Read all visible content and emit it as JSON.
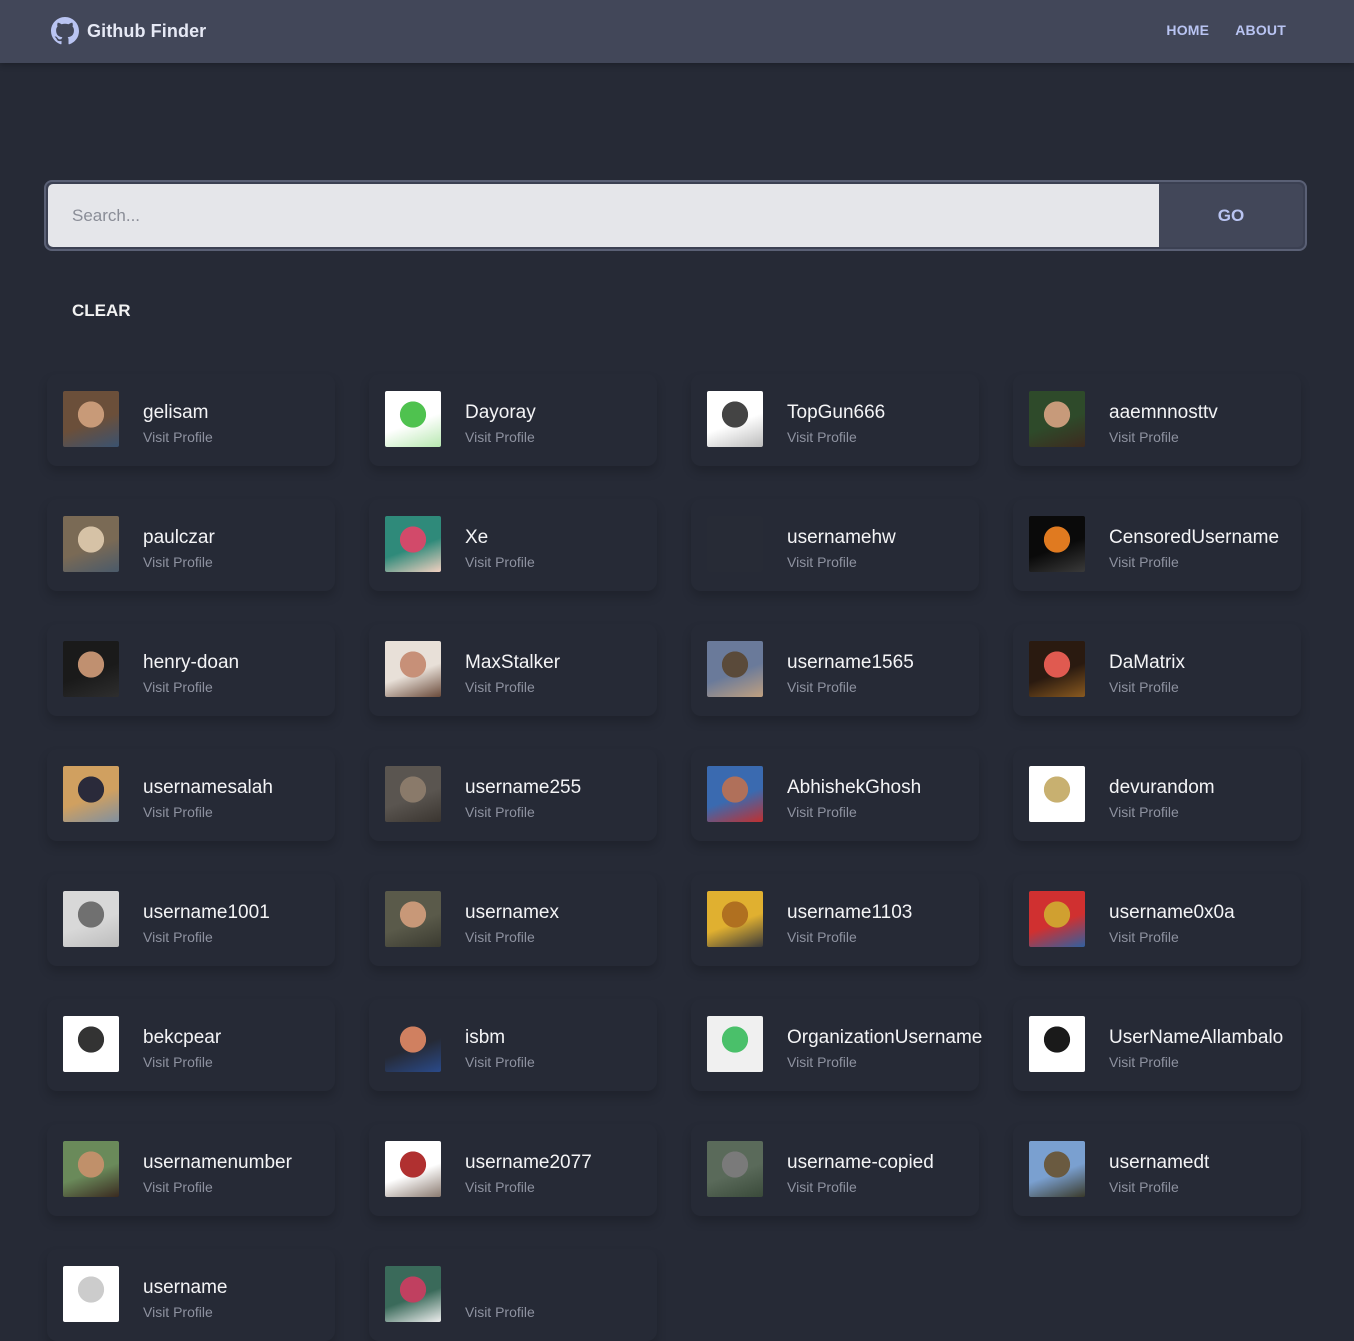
{
  "header": {
    "brand_title": "Github Finder",
    "brand_icon": "github-icon",
    "nav": [
      {
        "label": "HOME"
      },
      {
        "label": "ABOUT"
      }
    ]
  },
  "search": {
    "placeholder": "Search...",
    "value": "",
    "go_label": "GO",
    "clear_label": "CLEAR"
  },
  "users": [
    {
      "username": "gelisam",
      "link_label": "Visit Profile",
      "avatar_colors": [
        "#6b4f3a",
        "#c89a78",
        "#3a5270"
      ]
    },
    {
      "username": "Dayoray",
      "link_label": "Visit Profile",
      "avatar_colors": [
        "#ffffff",
        "#4fc24f",
        "#b7e8b0"
      ]
    },
    {
      "username": "TopGun666",
      "link_label": "Visit Profile",
      "avatar_colors": [
        "#ffffff",
        "#444444",
        "#bbbbbb"
      ]
    },
    {
      "username": "aaemnnosttv",
      "link_label": "Visit Profile",
      "avatar_colors": [
        "#2e4a2a",
        "#c79a7a",
        "#3d2a1f"
      ]
    },
    {
      "username": "paulczar",
      "link_label": "Visit Profile",
      "avatar_colors": [
        "#7a6a55",
        "#d6c2a6",
        "#4a5a6a"
      ]
    },
    {
      "username": "Xe",
      "link_label": "Visit Profile",
      "avatar_colors": [
        "#2f8a7a",
        "#d24a6a",
        "#f2d0c0"
      ]
    },
    {
      "username": "usernamehw",
      "link_label": "Visit Profile",
      "avatar_colors": [
        "#272b36",
        "#272b36",
        "#272b36"
      ]
    },
    {
      "username": "CensoredUsername",
      "link_label": "Visit Profile",
      "avatar_colors": [
        "#0a0a0a",
        "#e07a20",
        "#3a3a3a"
      ]
    },
    {
      "username": "henry-doan",
      "link_label": "Visit Profile",
      "avatar_colors": [
        "#1a1a1a",
        "#c09070",
        "#2e2e2e"
      ]
    },
    {
      "username": "MaxStalker",
      "link_label": "Visit Profile",
      "avatar_colors": [
        "#e8e0d8",
        "#c79078",
        "#6a4a3a"
      ]
    },
    {
      "username": "username1565",
      "link_label": "Visit Profile",
      "avatar_colors": [
        "#6a7a9a",
        "#5a4a3a",
        "#c0a080"
      ]
    },
    {
      "username": "DaMatrix",
      "link_label": "Visit Profile",
      "avatar_colors": [
        "#2a1a10",
        "#e05a50",
        "#8a5a20"
      ]
    },
    {
      "username": "usernamesalah",
      "link_label": "Visit Profile",
      "avatar_colors": [
        "#d0a060",
        "#2a2a3a",
        "#8090a0"
      ]
    },
    {
      "username": "username255",
      "link_label": "Visit Profile",
      "avatar_colors": [
        "#5a5550",
        "#8a7a6a",
        "#3a3530"
      ]
    },
    {
      "username": "AbhishekGhosh",
      "link_label": "Visit Profile",
      "avatar_colors": [
        "#3a6ab0",
        "#b0705a",
        "#c03030"
      ]
    },
    {
      "username": "devurandom",
      "link_label": "Visit Profile",
      "avatar_colors": [
        "#ffffff",
        "#c8b070",
        "#ffffff"
      ]
    },
    {
      "username": "username1001",
      "link_label": "Visit Profile",
      "avatar_colors": [
        "#d8d8d8",
        "#707070",
        "#bcbcbc"
      ]
    },
    {
      "username": "usernamex",
      "link_label": "Visit Profile",
      "avatar_colors": [
        "#5a5a4a",
        "#c89878",
        "#3a3a30"
      ]
    },
    {
      "username": "username1103",
      "link_label": "Visit Profile",
      "avatar_colors": [
        "#e0b030",
        "#b07020",
        "#3a3a3a"
      ]
    },
    {
      "username": "username0x0a",
      "link_label": "Visit Profile",
      "avatar_colors": [
        "#d03030",
        "#d0a030",
        "#3060a0"
      ]
    },
    {
      "username": "bekcpear",
      "link_label": "Visit Profile",
      "avatar_colors": [
        "#ffffff",
        "#333333",
        "#ffffff"
      ]
    },
    {
      "username": "isbm",
      "link_label": "Visit Profile",
      "avatar_colors": [
        "#262a36",
        "#d08060",
        "#2a4a8a"
      ]
    },
    {
      "username": "OrganizationUsername",
      "link_label": "Visit Profile",
      "avatar_colors": [
        "#f0f0f0",
        "#4ac06a",
        "#f0f0f0"
      ]
    },
    {
      "username": "UserNameAllambalo",
      "link_label": "Visit Profile",
      "avatar_colors": [
        "#ffffff",
        "#1a1a1a",
        "#ffffff"
      ]
    },
    {
      "username": "usernamenumber",
      "link_label": "Visit Profile",
      "avatar_colors": [
        "#6a8a5a",
        "#c0906a",
        "#3a2a20"
      ]
    },
    {
      "username": "username2077",
      "link_label": "Visit Profile",
      "avatar_colors": [
        "#ffffff",
        "#b03030",
        "#8a7a70"
      ]
    },
    {
      "username": "username-copied",
      "link_label": "Visit Profile",
      "avatar_colors": [
        "#5a6a5a",
        "#7a7a7a",
        "#3a4a3a"
      ]
    },
    {
      "username": "usernamedt",
      "link_label": "Visit Profile",
      "avatar_colors": [
        "#7aa0d0",
        "#6a5a40",
        "#3a3a2a"
      ]
    },
    {
      "username": "username",
      "link_label": "Visit Profile",
      "avatar_colors": [
        "#ffffff",
        "#cccccc",
        "#ffffff"
      ]
    },
    {
      "username": "",
      "link_label": "Visit Profile",
      "avatar_colors": [
        "#3a6a5a",
        "#c04060",
        "#eeeeee"
      ]
    }
  ]
}
